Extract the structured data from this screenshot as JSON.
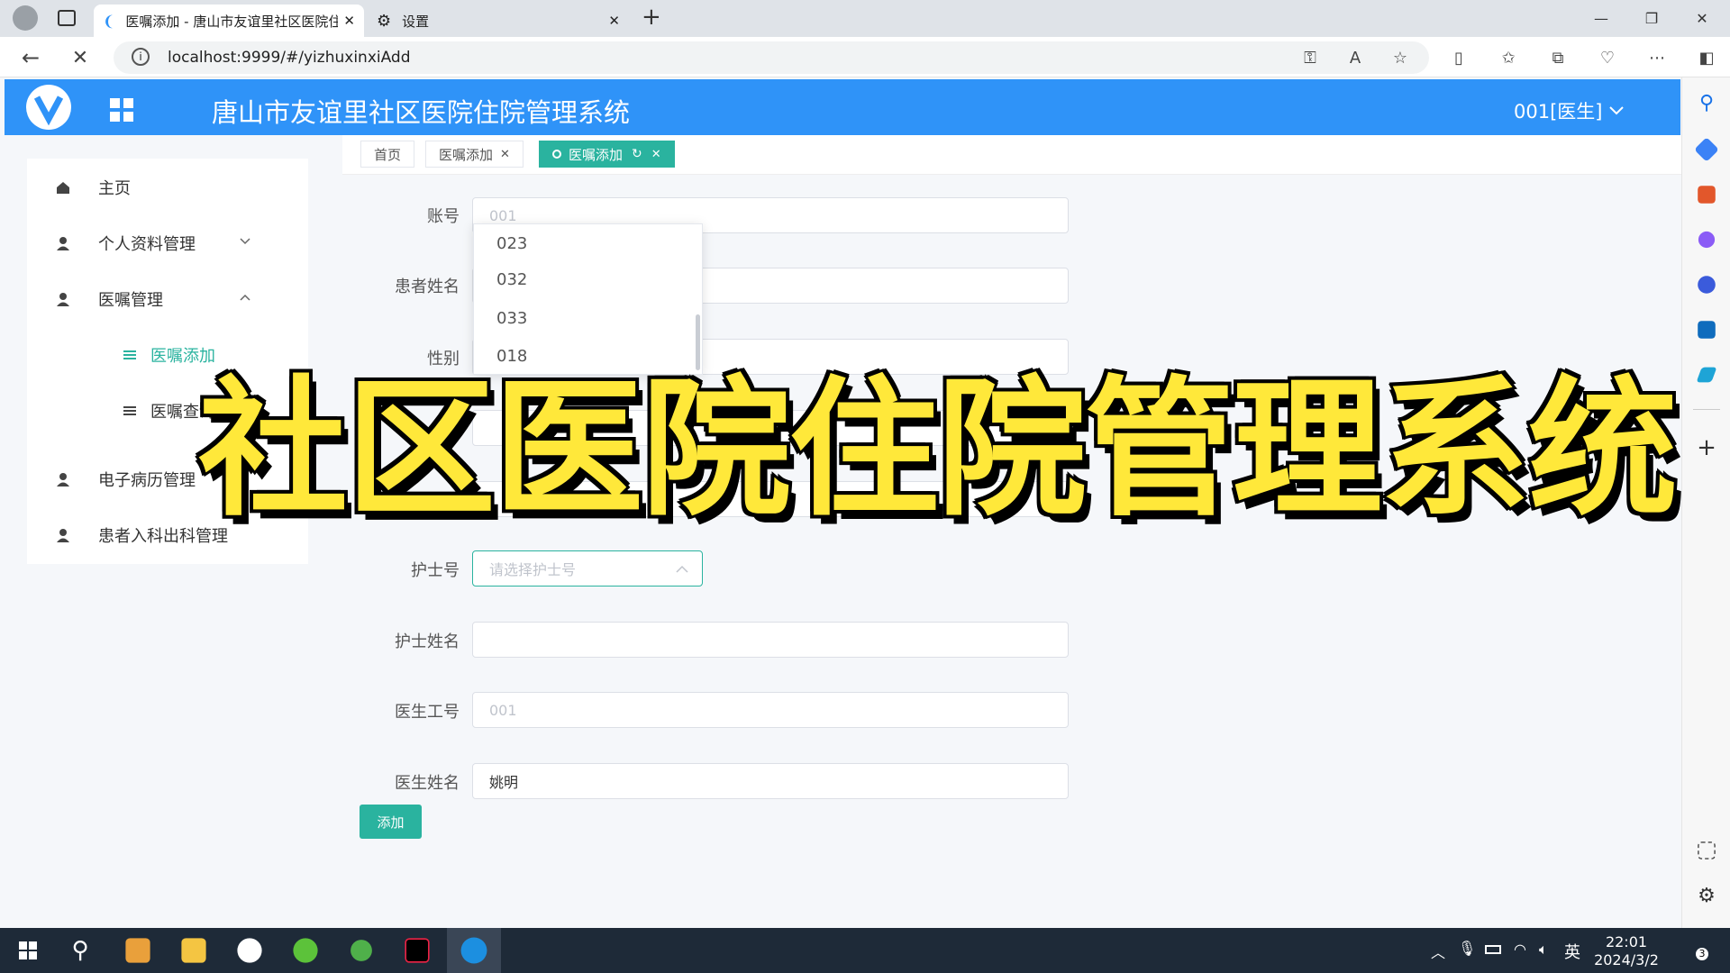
{
  "browser": {
    "active_tab_title": "医嘱添加 - 唐山市友谊里社区医院住院管理系统",
    "settings_tab_title": "设置",
    "url": "localhost:9999/#/yizhuxinxiAdd",
    "new_tab_symbol": "+",
    "minimize": "—",
    "maximize": "❐",
    "close": "✕"
  },
  "app": {
    "title": "唐山市友谊里社区医院住院管理系统",
    "user_menu": "001[医生]",
    "brand_color": "#2f93f8",
    "accent_color": "#2ab39f"
  },
  "sidebar": {
    "items": [
      {
        "label": "主页",
        "icon": "home-icon",
        "arrow": ""
      },
      {
        "label": "个人资料管理",
        "icon": "user-icon",
        "arrow": "down"
      },
      {
        "label": "医嘱管理",
        "icon": "user-icon",
        "arrow": "up"
      },
      {
        "label": "医嘱添加",
        "icon": "list-icon",
        "arrow": "",
        "active": true
      },
      {
        "label": "医嘱查询",
        "icon": "list-icon",
        "arrow": ""
      },
      {
        "label": "电子病历管理",
        "icon": "user-icon",
        "arrow": ""
      },
      {
        "label": "患者入科出科管理",
        "icon": "user-icon",
        "arrow": ""
      }
    ]
  },
  "page_tabs": [
    {
      "label": "首页"
    },
    {
      "label": "医嘱添加"
    },
    {
      "label": "医嘱添加"
    }
  ],
  "form": {
    "account": {
      "label": "账号",
      "value": "001"
    },
    "patient_name": {
      "label": "患者姓名",
      "value": ""
    },
    "gender": {
      "label": "性别",
      "value": ""
    },
    "nurse_no": {
      "label": "护士号",
      "placeholder": "请选择护士号"
    },
    "nurse_name": {
      "label": "护士姓名",
      "value": ""
    },
    "doctor_no": {
      "label": "医生工号",
      "value": "001"
    },
    "doctor_name": {
      "label": "医生姓名",
      "value": "姚明"
    },
    "submit_label": "添加"
  },
  "dropdown": {
    "options": [
      "023",
      "032",
      "033",
      "018"
    ]
  },
  "overlay": {
    "text": "社区医院住院管理系统"
  },
  "taskbar": {
    "time": "22:01",
    "date": "2024/3/2",
    "ime": "英",
    "notifications": "3"
  }
}
